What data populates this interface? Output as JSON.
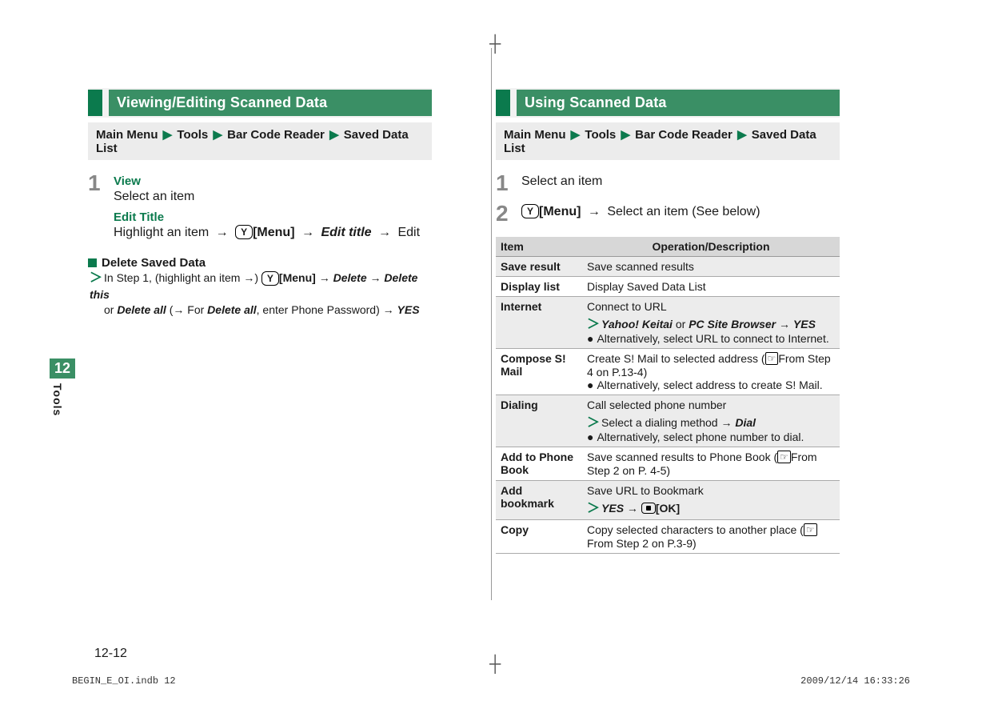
{
  "side": {
    "chapter": "12",
    "title": "Tools"
  },
  "page_number": "12-12",
  "left": {
    "heading": "Viewing/Editing Scanned Data",
    "nav": {
      "prefix": "Main Menu",
      "crumbs": [
        "Tools",
        "Bar Code Reader",
        "Saved Data List"
      ]
    },
    "step1_num": "1",
    "view_h": "View",
    "view_line": "Select an item",
    "edit_h": "Edit Title",
    "edit_pre": "Highlight an item",
    "menu": "[Menu]",
    "edit_action": "Edit title",
    "edit_post": "Edit",
    "delete_h": "Delete Saved Data",
    "delete_pre": "In Step 1, (highlight an item",
    "delete_sep": ")",
    "delete_menu": "[Menu]",
    "delete_a": "Delete",
    "delete_b": "Delete this",
    "delete_or": "or",
    "delete_c": "Delete all",
    "delete_noteA": "(",
    "delete_for": "For",
    "delete_noteB": ", enter Phone Password)",
    "delete_yes": "YES"
  },
  "right": {
    "heading": "Using Scanned Data",
    "nav": {
      "prefix": "Main Menu",
      "crumbs": [
        "Tools",
        "Bar Code Reader",
        "Saved Data List"
      ]
    },
    "step1_num": "1",
    "step1": "Select an item",
    "step2_num": "2",
    "step2_menu": "[Menu]",
    "step2_post": "Select an item (See below)",
    "th1": "Item",
    "th2": "Operation/Description",
    "rows": [
      {
        "item": "Save result",
        "desc_main": "Save scanned results"
      },
      {
        "item": "Display list",
        "desc_main": "Display Saved Data List"
      },
      {
        "item": "Internet",
        "desc_main": "Connect to URL",
        "sub_a": "Yahoo! Keitai",
        "sub_or": "or",
        "sub_b": "PC Site Browser",
        "sub_yes": "YES",
        "alt": "Alternatively, select URL to connect to Internet."
      },
      {
        "item": "Compose S! Mail",
        "desc_main": "Create S! Mail to selected address (",
        "desc_ref": "From Step 4 on P.13-4)",
        "alt": "Alternatively, select address to create S! Mail."
      },
      {
        "item": "Dialing",
        "desc_main": "Call selected phone number",
        "sub_line": "Select a dialing method",
        "sub_dial": "Dial",
        "alt": "Alternatively, select phone number to dial."
      },
      {
        "item": "Add to Phone Book",
        "desc_main": "Save scanned results to Phone Book (",
        "desc_ref": "From Step 2 on P. 4-5)"
      },
      {
        "item": "Add bookmark",
        "desc_main": "Save URL to Bookmark",
        "sub_yes": "YES",
        "sub_ok": "[OK]"
      },
      {
        "item": "Copy",
        "desc_main": "Copy selected characters to another place (",
        "desc_ref": "From Step 2 on P.3-9)"
      }
    ]
  },
  "footer": {
    "file": "BEGIN_E_OI.indb   12",
    "stamp": "2009/12/14   16:33:26"
  }
}
